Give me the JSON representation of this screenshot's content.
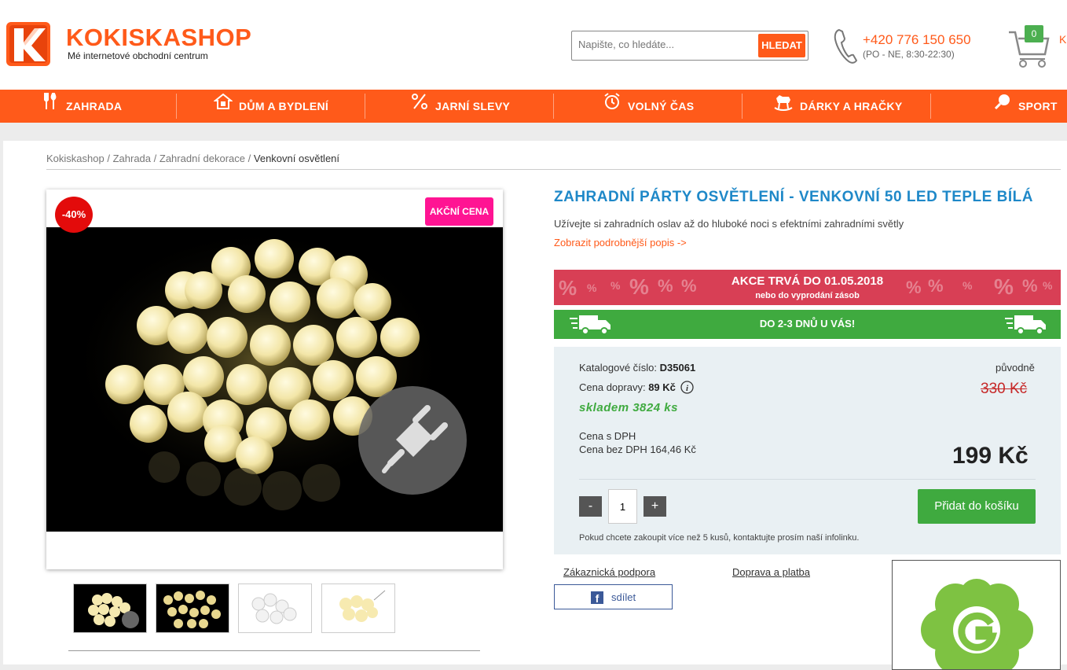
{
  "header": {
    "brand": "KOKISKASHOP",
    "tagline": "Mé internetové obchodní centrum",
    "search": {
      "placeholder": "Napište, co hledáte...",
      "button": "HLEDAT"
    },
    "phone": "+420 776 150 650",
    "hours": "(PO - NE, 8:30-22:30)",
    "cart_count": "0",
    "cart_label_cut": "K"
  },
  "nav": [
    {
      "label": "ZAHRADA",
      "icon": "garden-tools-icon"
    },
    {
      "label": "DŮM A BYDLENÍ",
      "icon": "house-icon"
    },
    {
      "label": "JARNÍ SLEVY",
      "icon": "percent-icon"
    },
    {
      "label": "VOLNÝ ČAS",
      "icon": "alarm-clock-icon"
    },
    {
      "label": "DÁRKY A HRAČKY",
      "icon": "rocking-horse-icon"
    },
    {
      "label": "SPORT",
      "icon": "ping-pong-icon"
    }
  ],
  "breadcrumb": {
    "items": [
      "Kokiskashop",
      "Zahrada",
      "Zahradní dekorace"
    ],
    "current": "Venkovní osvětlení",
    "separator": "/"
  },
  "gallery": {
    "discount_badge": "-40%",
    "promo_badge": "AKČNÍ CENA",
    "thumbnails": 4
  },
  "product": {
    "title": "ZAHRADNÍ PÁRTY OSVĚTLENÍ - VENKOVNÍ 50 LED TEPLE BÍLÁ",
    "subtitle": "Užívejte si zahradních oslav až do hluboké noci s efektními zahradními světly",
    "more_link": "Zobrazit podrobnější popis ->",
    "promo_title": "AKCE TRVÁ DO 01.05.2018",
    "promo_sub": "nebo do vyprodání zásob",
    "delivery": "DO 2-3 DNŮ U VÁS!",
    "catalog_label": "Katalogové číslo:",
    "catalog_number": "D35061",
    "shipping_label": "Cena dopravy:",
    "shipping_price": "89 Kč",
    "stock": "skladem 3824 ks",
    "orig_label": "původně",
    "orig_price": "330 Kč",
    "price_vat_label": "Cena s DPH",
    "price_novat_label": "Cena bez DPH 164,46 Kč",
    "price": "199 Kč",
    "qty": "1",
    "qty_minus": "-",
    "qty_plus": "+",
    "add_to_cart": "Přidat do košíku",
    "note": "Pokud chcete zakoupit více než 5 kusů, kontaktujte prosím naší infolinku."
  },
  "links": {
    "support": "Zákaznická podpora",
    "shipping": "Doprava a platba",
    "share": "sdílet"
  },
  "colors": {
    "brand_orange": "#ff5a1a",
    "title_blue": "#1e88c8",
    "promo_red": "#d83f55",
    "green": "#3faa3f",
    "badge_pink": "#ff1493"
  }
}
